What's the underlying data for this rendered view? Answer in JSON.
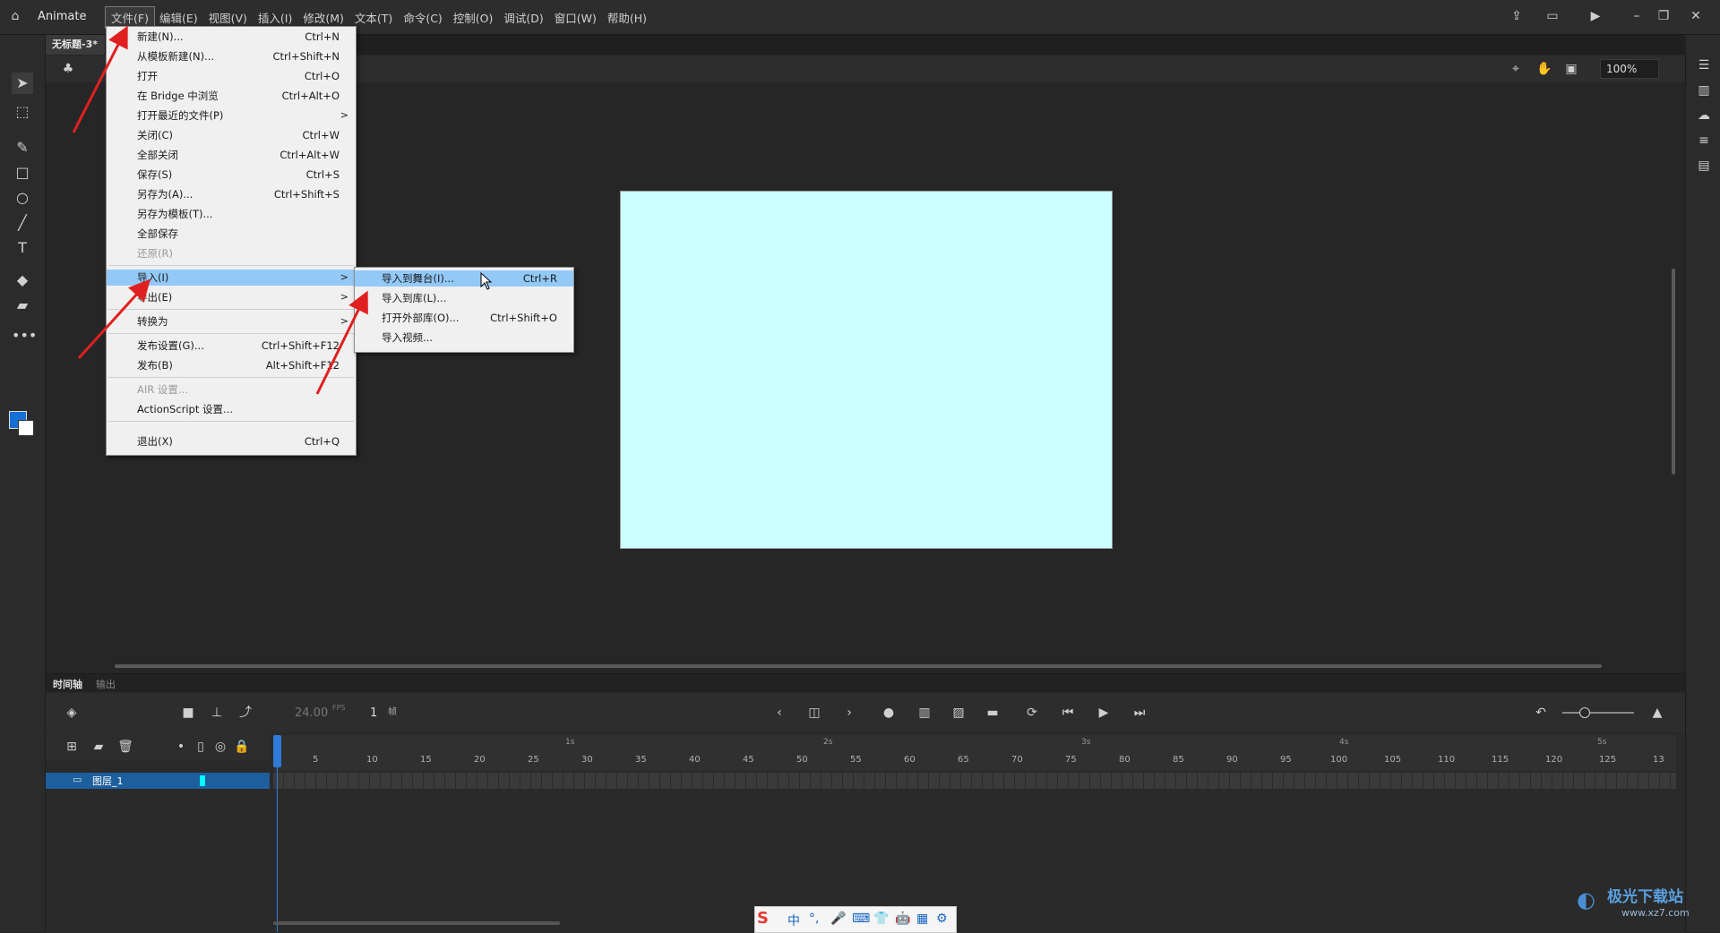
{
  "app": {
    "name": "Animate"
  },
  "menubar": {
    "items": [
      "文件(F)",
      "编辑(E)",
      "视图(V)",
      "插入(I)",
      "修改(M)",
      "文本(T)",
      "命令(C)",
      "控制(O)",
      "调试(D)",
      "窗口(W)",
      "帮助(H)"
    ]
  },
  "document": {
    "tab": "无标题-3*"
  },
  "zoom": {
    "value": "100%"
  },
  "file_menu": {
    "items": [
      {
        "label": "新建(N)...",
        "shortcut": "Ctrl+N"
      },
      {
        "label": "从模板新建(N)...",
        "shortcut": "Ctrl+Shift+N"
      },
      {
        "label": "打开",
        "shortcut": "Ctrl+O"
      },
      {
        "label": "在 Bridge 中浏览",
        "shortcut": "Ctrl+Alt+O"
      },
      {
        "label": "打开最近的文件(P)",
        "shortcut": ">"
      },
      {
        "label": "关闭(C)",
        "shortcut": "Ctrl+W"
      },
      {
        "label": "全部关闭",
        "shortcut": "Ctrl+Alt+W"
      },
      {
        "label": "保存(S)",
        "shortcut": "Ctrl+S"
      },
      {
        "label": "另存为(A)...",
        "shortcut": "Ctrl+Shift+S"
      },
      {
        "label": "另存为模板(T)...",
        "shortcut": ""
      },
      {
        "label": "全部保存",
        "shortcut": ""
      },
      {
        "label": "还原(R)",
        "shortcut": ""
      },
      {
        "label": "导入(I)",
        "shortcut": ">"
      },
      {
        "label": "导出(E)",
        "shortcut": ">"
      },
      {
        "label": "转换为",
        "shortcut": ">"
      },
      {
        "label": "发布设置(G)...",
        "shortcut": "Ctrl+Shift+F12"
      },
      {
        "label": "发布(B)",
        "shortcut": "Alt+Shift+F12"
      },
      {
        "label": "AIR 设置...",
        "shortcut": ""
      },
      {
        "label": "ActionScript 设置...",
        "shortcut": ""
      },
      {
        "label": "退出(X)",
        "shortcut": "Ctrl+Q"
      }
    ]
  },
  "import_submenu": {
    "items": [
      {
        "label": "导入到舞台(I)...",
        "shortcut": "Ctrl+R"
      },
      {
        "label": "导入到库(L)...",
        "shortcut": ""
      },
      {
        "label": "打开外部库(O)...",
        "shortcut": "Ctrl+Shift+O"
      },
      {
        "label": "导入视频...",
        "shortcut": ""
      }
    ]
  },
  "timeline": {
    "tabs": [
      "时间轴",
      "输出"
    ],
    "fps": "24.00",
    "fps_unit": "FPS",
    "frame": "1",
    "frame_unit": "帧",
    "layer_name": "图层_1",
    "seconds": [
      "1s",
      "2s",
      "3s",
      "4s",
      "5s"
    ],
    "ticks": [
      "5",
      "10",
      "15",
      "20",
      "25",
      "30",
      "35",
      "40",
      "45",
      "50",
      "55",
      "60",
      "65",
      "70",
      "75",
      "80",
      "85",
      "90",
      "95",
      "100",
      "105",
      "110",
      "115",
      "120",
      "125",
      "13"
    ]
  },
  "ime": {
    "items": [
      "中",
      "°,",
      "🎤",
      "⌨",
      "👕",
      "🤖",
      "▦",
      "⚙"
    ]
  },
  "watermark": {
    "text": "极光下载站",
    "url_text": "www.xz7.com"
  },
  "colors": {
    "stage": "#ccffff",
    "accent": "#2f7bd8",
    "highlight": "#93c9f7",
    "arrow": "#e02020"
  }
}
